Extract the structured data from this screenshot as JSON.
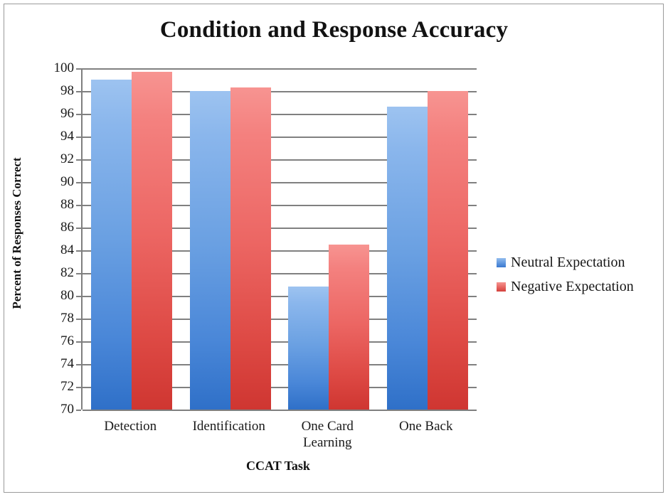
{
  "chart_data": {
    "type": "bar",
    "title": "Condition and Response Accuracy",
    "xlabel": "CCAT Task",
    "ylabel": "Percent of Responses Correct",
    "categories": [
      "Detection",
      "Identification",
      "One Card Learning",
      "One Back"
    ],
    "category_lines": [
      [
        "Detection"
      ],
      [
        "Identification"
      ],
      [
        "One Card",
        "Learning"
      ],
      [
        "One Back"
      ]
    ],
    "series": [
      {
        "name": "Neutral Expectation",
        "color": "#5B9BD5",
        "values": [
          99.0,
          98.0,
          80.8,
          96.6
        ]
      },
      {
        "name": "Negative Expectation",
        "color": "#E15759",
        "values": [
          99.7,
          98.3,
          84.5,
          98.0
        ]
      }
    ],
    "ylim": [
      70,
      100
    ],
    "ytick_step": 2,
    "yticks": [
      100,
      98,
      96,
      94,
      92,
      90,
      88,
      86,
      84,
      82,
      80,
      78,
      76,
      74,
      72,
      70
    ],
    "grid": true,
    "legend_position": "right"
  }
}
